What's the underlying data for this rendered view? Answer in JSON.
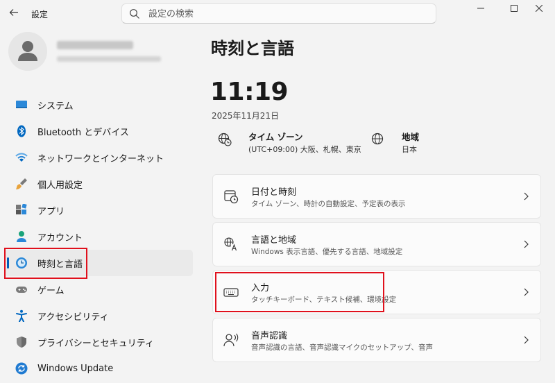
{
  "app": {
    "title": "設定"
  },
  "search": {
    "placeholder": "設定の検索"
  },
  "sidebar": {
    "items": [
      {
        "label": "システム",
        "icon": "system-icon"
      },
      {
        "label": "Bluetooth とデバイス",
        "icon": "bluetooth-icon"
      },
      {
        "label": "ネットワークとインターネット",
        "icon": "wifi-icon"
      },
      {
        "label": "個人用設定",
        "icon": "brush-icon"
      },
      {
        "label": "アプリ",
        "icon": "apps-icon"
      },
      {
        "label": "アカウント",
        "icon": "account-icon"
      },
      {
        "label": "時刻と言語",
        "icon": "time-language-icon",
        "selected": true
      },
      {
        "label": "ゲーム",
        "icon": "gamepad-icon"
      },
      {
        "label": "アクセシビリティ",
        "icon": "accessibility-icon"
      },
      {
        "label": "プライバシーとセキュリティ",
        "icon": "shield-icon"
      },
      {
        "label": "Windows Update",
        "icon": "update-icon"
      }
    ]
  },
  "main": {
    "title": "時刻と言語",
    "time": "11:19",
    "date": "2025年11月21日",
    "timezone": {
      "title": "タイム ゾーン",
      "value": "(UTC+09:00) 大阪、札幌、東京"
    },
    "region": {
      "title": "地域",
      "value": "日本"
    },
    "cards": [
      {
        "title": "日付と時刻",
        "subtitle": "タイム ゾーン、時計の自動設定、予定表の表示",
        "icon": "date-time-icon"
      },
      {
        "title": "言語と地域",
        "subtitle": "Windows 表示言語、優先する言語、地域設定",
        "icon": "language-icon"
      },
      {
        "title": "入力",
        "subtitle": "タッチキーボード、テキスト候補、環境設定",
        "icon": "keyboard-icon"
      },
      {
        "title": "音声認識",
        "subtitle": "音声認識の言語、音声認識マイクのセットアップ、音声",
        "icon": "speech-icon"
      }
    ]
  },
  "colors": {
    "accent": "#005fb8",
    "highlight": "#e0101c"
  }
}
